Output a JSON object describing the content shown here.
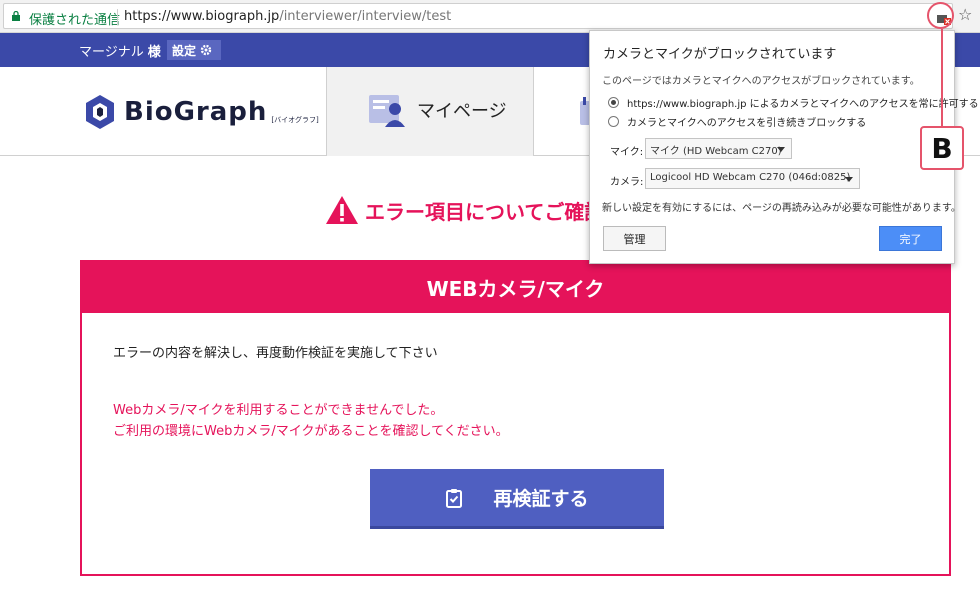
{
  "address_bar": {
    "secure_label": "保護された通信",
    "url_host": "https://www.biograph.jp",
    "url_path": "/interviewer/interview/test"
  },
  "topbar": {
    "user_name": "マージナル",
    "honorific": "様",
    "settings_label": "設定"
  },
  "header": {
    "logo_text": "BioGraph",
    "logo_sub": "[バイオグラフ]",
    "nav_mypage": "マイページ"
  },
  "error": {
    "heading": "エラー項目についてご確認",
    "box_title": "WEBカメラ/マイク",
    "instruction": "エラーの内容を解決し、再度動作検証を実施して下さい",
    "message_line1": "Webカメラ/マイクを利用することができませんでした。",
    "message_line2": "ご利用の環境にWebカメラ/マイクがあることを確認してください。",
    "retry_button": "再検証する"
  },
  "popup": {
    "title": "カメラとマイクがブロックされています",
    "subtitle": "このページではカメラとマイクへのアクセスがブロックされています。",
    "option_allow": "https://www.biograph.jp によるカメラとマイクへのアクセスを常に許可する",
    "option_block": "カメラとマイクへのアクセスを引き続きブロックする",
    "mic_label": "マイク:",
    "mic_value": "マイク (HD Webcam C270)",
    "camera_label": "カメラ:",
    "camera_value": "Logicool HD Webcam C270 (046d:0825)",
    "note": "新しい設定を有効にするには、ページの再読み込みが必要な可能性があります。",
    "manage_button": "管理",
    "done_button": "完了"
  },
  "annotation": {
    "label": "B"
  },
  "colors": {
    "brand_blue": "#3b49a8",
    "error_pink": "#e5135a",
    "button_blue": "#4f5fc1",
    "done_blue": "#4c8ef7",
    "annotation_red": "#e5546b"
  }
}
